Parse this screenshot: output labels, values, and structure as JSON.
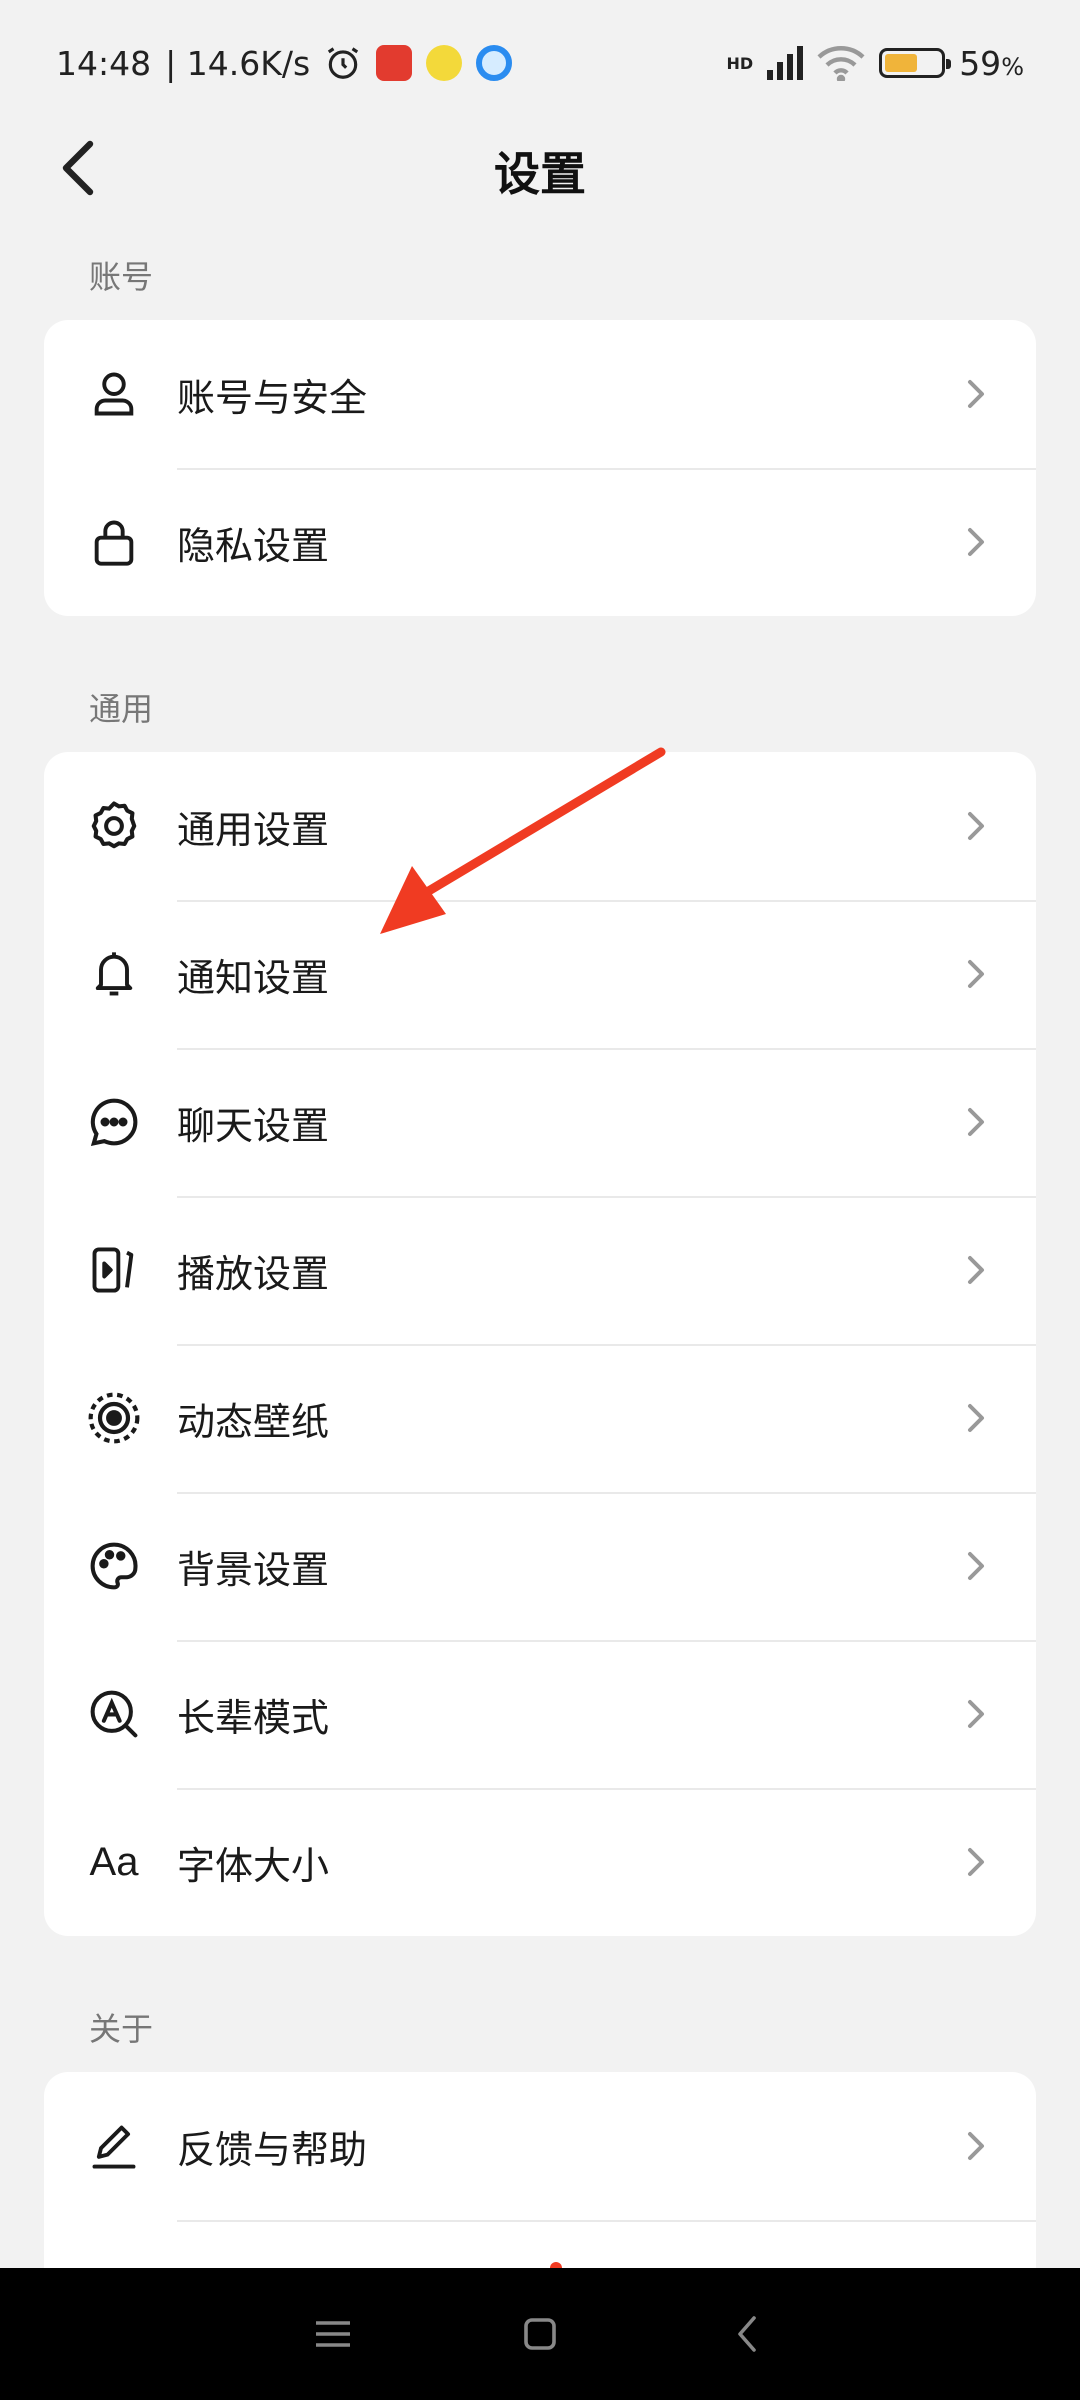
{
  "status_bar": {
    "time": "14:48",
    "network_speed": "| 14.6K/s",
    "signal": "HD",
    "battery_percent": "59",
    "battery_sign": "%",
    "battery_level": 0.59
  },
  "header": {
    "title": "设置"
  },
  "sections": [
    {
      "label": "账号",
      "items": [
        {
          "label": "账号与安全",
          "icon": "person-icon"
        },
        {
          "label": "隐私设置",
          "icon": "lock-icon"
        }
      ]
    },
    {
      "label": "通用",
      "items": [
        {
          "label": "通用设置",
          "icon": "gear-icon"
        },
        {
          "label": "通知设置",
          "icon": "bell-icon"
        },
        {
          "label": "聊天设置",
          "icon": "chat-bubble-icon"
        },
        {
          "label": "播放设置",
          "icon": "play-screen-icon"
        },
        {
          "label": "动态壁纸",
          "icon": "dynamic-wallpaper-icon"
        },
        {
          "label": "背景设置",
          "icon": "palette-icon"
        },
        {
          "label": "长辈模式",
          "icon": "elder-mode-icon"
        },
        {
          "label": "字体大小",
          "icon": "font-size-icon",
          "icon_text": "Aa"
        }
      ]
    },
    {
      "label": "关于",
      "items": [
        {
          "label": "反馈与帮助",
          "icon": "pencil-icon"
        }
      ]
    }
  ],
  "colors": {
    "background": "#f2f2f2",
    "card": "#ffffff",
    "arrow": "#f03b22",
    "battery": "#f0b43a"
  }
}
